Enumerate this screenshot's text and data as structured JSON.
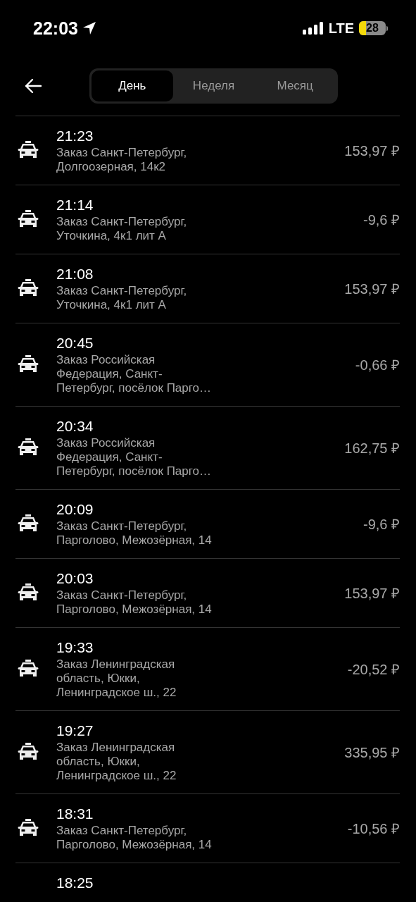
{
  "status_bar": {
    "time": "22:03",
    "network": "LTE",
    "battery": "28"
  },
  "period_tabs": [
    {
      "label": "День",
      "selected": true
    },
    {
      "label": "Неделя",
      "selected": false
    },
    {
      "label": "Месяц",
      "selected": false
    }
  ],
  "orders": [
    {
      "time": "21:23",
      "description": "Заказ Санкт-Петербург, Долгоозерная, 14к2",
      "amount": "153,97 ₽"
    },
    {
      "time": "21:14",
      "description": "Заказ Санкт-Петербург, Уточкина, 4к1 лит А",
      "amount": "-9,6 ₽"
    },
    {
      "time": "21:08",
      "description": "Заказ Санкт-Петербург, Уточкина, 4к1 лит А",
      "amount": "153,97 ₽"
    },
    {
      "time": "20:45",
      "description": "Заказ Российская Федерация, Санкт-Петербург, посёлок Парго…",
      "amount": "-0,66 ₽"
    },
    {
      "time": "20:34",
      "description": "Заказ Российская Федерация, Санкт-Петербург, посёлок Парго…",
      "amount": "162,75 ₽"
    },
    {
      "time": "20:09",
      "description": "Заказ Санкт-Петербург, Парголово, Межозёрная, 14",
      "amount": "-9,6 ₽"
    },
    {
      "time": "20:03",
      "description": "Заказ Санкт-Петербург, Парголово, Межозёрная, 14",
      "amount": "153,97 ₽"
    },
    {
      "time": "19:33",
      "description": "Заказ Ленинградская область, Юкки, Ленинградское ш., 22",
      "amount": "-20,52 ₽"
    },
    {
      "time": "19:27",
      "description": "Заказ Ленинградская область, Юкки, Ленинградское ш., 22",
      "amount": "335,95 ₽"
    },
    {
      "time": "18:31",
      "description": "Заказ Санкт-Петербург, Парголово, Межозёрная, 14",
      "amount": "-10,56 ₽"
    },
    {
      "time": "18:25"
    }
  ]
}
